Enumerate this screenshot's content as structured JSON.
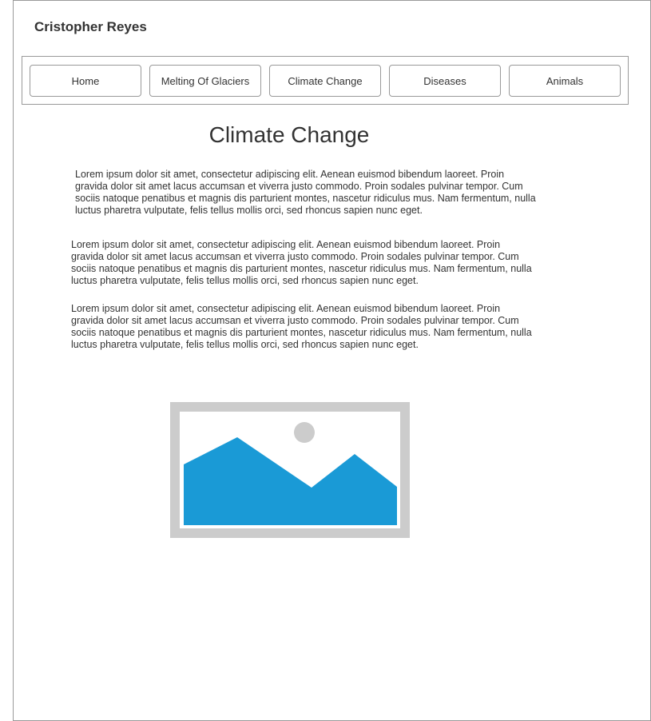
{
  "header": {
    "site_name": "Cristopher Reyes"
  },
  "nav": {
    "items": [
      {
        "label": "Home"
      },
      {
        "label": "Melting Of Glaciers"
      },
      {
        "label": "Climate Change"
      },
      {
        "label": "Diseases"
      },
      {
        "label": "Animals"
      }
    ]
  },
  "main": {
    "title": "Climate Change",
    "paragraphs": [
      {
        "text": "Lorem ipsum dolor sit amet, consectetur adipiscing elit. Aenean euismod bibendum laoreet. Proin gravida dolor sit amet lacus accumsan et viverra justo commodo. Proin sodales pulvinar tempor. Cum sociis natoque penatibus et magnis dis parturient montes, nascetur ridiculus mus. Nam fermentum, nulla luctus pharetra vulputate, felis tellus mollis orci, sed rhoncus sapien nunc eget."
      },
      {
        "text": "Lorem ipsum dolor sit amet, consectetur adipiscing elit. Aenean euismod bibendum laoreet. Proin gravida dolor sit amet lacus accumsan et viverra justo commodo. Proin sodales pulvinar tempor. Cum sociis natoque penatibus et magnis dis parturient montes, nascetur ridiculus mus. Nam fermentum, nulla luctus pharetra vulputate, felis tellus mollis orci, sed rhoncus sapien nunc eget."
      },
      {
        "text": "Lorem ipsum dolor sit amet, consectetur adipiscing elit. Aenean euismod bibendum laoreet. Proin gravida dolor sit amet lacus accumsan et viverra justo commodo. Proin sodales pulvinar tempor. Cum sociis natoque penatibus et magnis dis parturient montes, nascetur ridiculus mus. Nam fermentum, nulla luctus pharetra vulputate, felis tellus mollis orci, sed rhoncus sapien nunc eget."
      }
    ],
    "image": {
      "icon": "image-placeholder-icon",
      "frame_color": "#cccccc",
      "mountain_color": "#1a9ad6",
      "sun_color": "#cccccc"
    }
  },
  "colors": {
    "border": "#999999",
    "text": "#333333",
    "background": "#ffffff"
  }
}
